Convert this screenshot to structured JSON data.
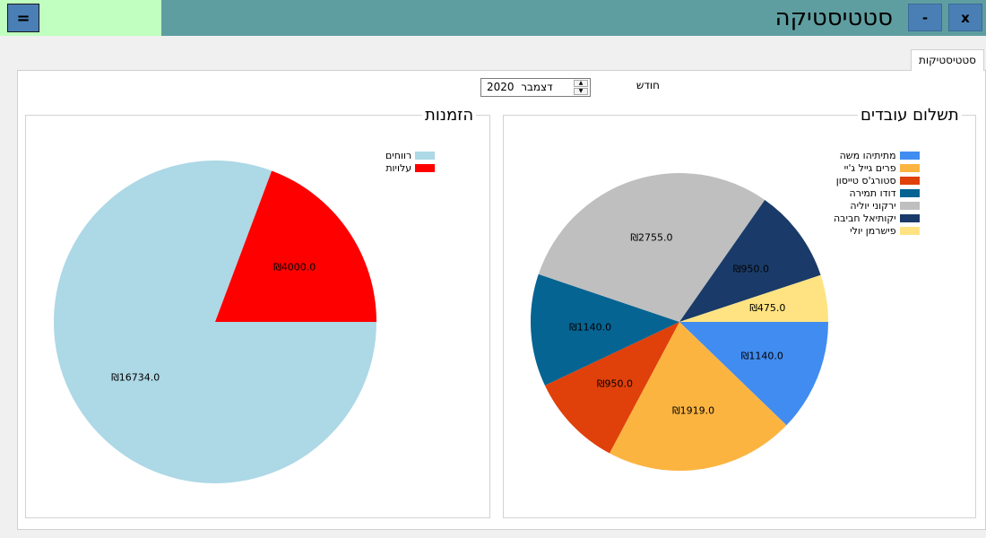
{
  "window": {
    "title": "סטטיסטיקה",
    "menu_button": "=",
    "minimize_button": "-",
    "close_button": "x"
  },
  "tabs": [
    {
      "label": "סטטיסטיקות",
      "selected": true
    }
  ],
  "month_selector": {
    "label": "חודש",
    "month": "דצמבר",
    "year": "2020"
  },
  "chart_data": [
    {
      "type": "pie",
      "title": "הזמנות",
      "categories": [
        "רווחים",
        "עלויות"
      ],
      "values": [
        16734.0,
        4000.0
      ],
      "labels": [
        "₪16734.0",
        "₪4000.0"
      ],
      "colors": [
        "#add8e6",
        "#ff0000"
      ],
      "legend_position": "top-right"
    },
    {
      "type": "pie",
      "title": "תשלום עובדים",
      "categories": [
        "מתיתיהו משה",
        "פרים גייל ג'יי",
        "סטורג'ס טייסון",
        "דודו תמירה",
        "ירקוני יוליה",
        "יקותיאל חביבה",
        "פישרמן יולי"
      ],
      "values": [
        1140.0,
        1919.0,
        950.0,
        1140.0,
        2755.0,
        950.0,
        475.0
      ],
      "labels": [
        "₪1140.0",
        "₪1919.0",
        "₪950.0",
        "₪1140.0",
        "₪2755.0",
        "₪950.0",
        "₪475.0"
      ],
      "colors": [
        "#418cf0",
        "#fcb441",
        "#e0400a",
        "#056492",
        "#bfbfbf",
        "#1a3b69",
        "#ffe382"
      ],
      "legend_position": "top-right"
    }
  ]
}
